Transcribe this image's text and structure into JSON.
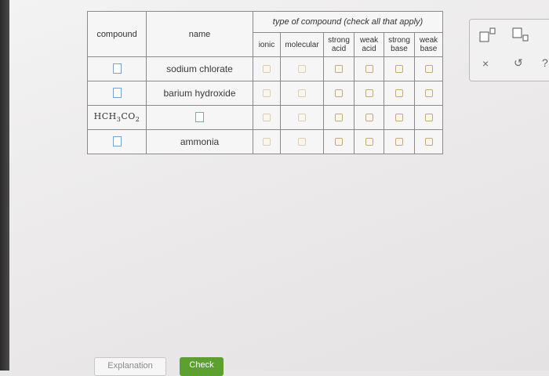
{
  "table": {
    "col_compound": "compound",
    "col_name": "name",
    "type_header": "type of compound (check all that apply)",
    "types": {
      "ionic": "ionic",
      "molecular": "molecular",
      "strong_acid_1": "strong",
      "strong_acid_2": "acid",
      "weak_acid_1": "weak",
      "weak_acid_2": "acid",
      "strong_base_1": "strong",
      "strong_base_2": "base",
      "weak_base_1": "weak",
      "weak_base_2": "base"
    },
    "rows": [
      {
        "compound": "",
        "name": "sodium chlorate",
        "checked": [
          false,
          false,
          false,
          false,
          false,
          false
        ]
      },
      {
        "compound": "",
        "name": "barium hydroxide",
        "checked": [
          false,
          false,
          false,
          false,
          false,
          false
        ]
      },
      {
        "compound": "HCH3CO2",
        "name": "",
        "checked": [
          false,
          false,
          false,
          false,
          false,
          false
        ]
      },
      {
        "compound": "",
        "name": "ammonia",
        "checked": [
          false,
          false,
          false,
          false,
          false,
          false
        ]
      }
    ],
    "formula_parts": {
      "a": "HCH",
      "sub1": "3",
      "b": "CO",
      "sub2": "2"
    }
  },
  "tools": {
    "superscript_icon": "superscript-box-icon",
    "subscript_icon": "subscript-box-icon",
    "clear_symbol": "×",
    "undo_symbol": "↺",
    "help_symbol": "?"
  },
  "footer": {
    "explanation_label": "Explanation",
    "check_label": "Check"
  },
  "colors": {
    "check_button": "#5ca02f",
    "checkbox_border": "#c9a877",
    "input_border": "#7aa4cf"
  }
}
